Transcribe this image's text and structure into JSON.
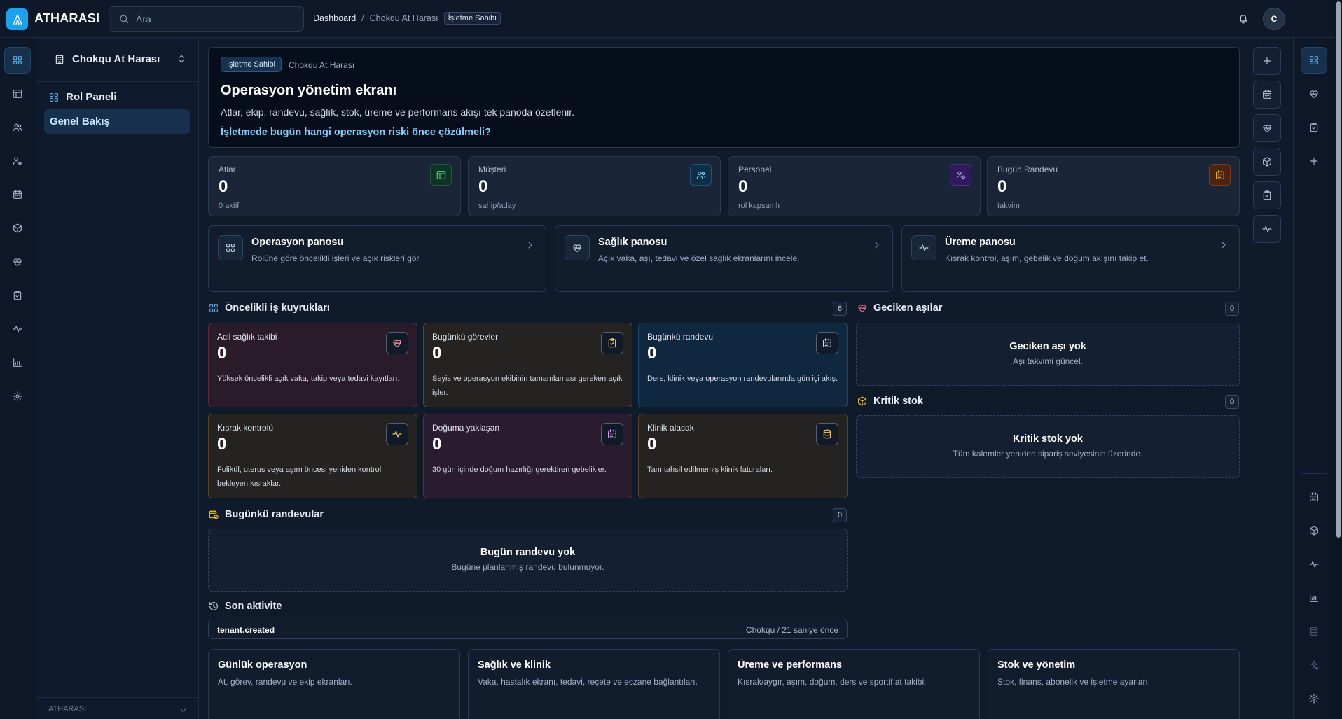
{
  "app": {
    "brand": "ATHARASI",
    "search_placeholder": "Ara"
  },
  "breadcrumb": {
    "home": "Dashboard",
    "separator": "/",
    "current": "Chokqu At Harası",
    "role_tag": "İşletme Sahibi"
  },
  "user": {
    "avatar_initial": "C"
  },
  "sidebar": {
    "workspace": "Chokqu At Harası",
    "section": "Rol Paneli",
    "active_item": "Genel Bakış",
    "footer": "ATHARASI"
  },
  "hero": {
    "badge": "İşletme Sahibi",
    "context": "Chokqu At Harası",
    "title": "Operasyon yönetim ekranı",
    "description": "Atlar, ekip, randevu, sağlık, stok, üreme ve performans akışı tek panoda özetlenir.",
    "question": "İşletmede bugün hangi operasyon riski önce çözülmeli?"
  },
  "stats": [
    {
      "label": "Atlar",
      "value": "0",
      "sub": "0 aktif",
      "icon": "horse-board-icon",
      "color": "#22c55e"
    },
    {
      "label": "Müşteri",
      "value": "0",
      "sub": "sahip/aday",
      "icon": "users-icon",
      "color": "#38bdf8"
    },
    {
      "label": "Personel",
      "value": "0",
      "sub": "rol kapsamlı",
      "icon": "user-cog-icon",
      "color": "#a78bfa"
    },
    {
      "label": "Bugün Randevu",
      "value": "0",
      "sub": "takvim",
      "icon": "calendar-icon",
      "color": "#f59e0b"
    }
  ],
  "panels": [
    {
      "title": "Operasyon panosu",
      "desc": "Rolüne göre öncelikli işleri ve açık riskleri gör."
    },
    {
      "title": "Sağlık panosu",
      "desc": "Açık vaka, aşı, tedavi ve özel sağlık ekranlarını incele."
    },
    {
      "title": "Üreme panosu",
      "desc": "Kısrak kontrol, aşım, gebelik ve doğum akışını takip et."
    }
  ],
  "queues": {
    "title": "Öncelikli iş kuyrukları",
    "count": "6",
    "items": [
      {
        "label": "Acil sağlık takibi",
        "value": "0",
        "desc": "Yüksek öncelikli açık vaka, takip veya tedavi kayıtları."
      },
      {
        "label": "Bugünkü görevler",
        "value": "0",
        "desc": "Seyis ve operasyon ekibinin tamamlaması gereken açık işler."
      },
      {
        "label": "Bugünkü randevu",
        "value": "0",
        "desc": "Ders, klinik veya operasyon randevularında gün içi akış."
      },
      {
        "label": "Kısrak kontrolü",
        "value": "0",
        "desc": "Folikül, uterus veya aşım öncesi yeniden kontrol bekleyen kısraklar."
      },
      {
        "label": "Doğuma yaklaşan",
        "value": "0",
        "desc": "30 gün içinde doğum hazırlığı gerektiren gebelikler."
      },
      {
        "label": "Klinik alacak",
        "value": "0",
        "desc": "Tam tahsil edilmemiş klinik faturaları."
      }
    ]
  },
  "overdue_vaccines": {
    "title": "Geciken aşılar",
    "count": "0",
    "empty_title": "Geciken aşı yok",
    "empty_desc": "Aşı takvimi güncel."
  },
  "critical_stock": {
    "title": "Kritik stok",
    "count": "0",
    "empty_title": "Kritik stok yok",
    "empty_desc": "Tüm kalemler yeniden sipariş seviyesinin üzerinde."
  },
  "appointments": {
    "title": "Bugünkü randevular",
    "count": "0",
    "empty_title": "Bugün randevu yok",
    "empty_desc": "Bugüne planlanmış randevu bulunmuyor."
  },
  "activity": {
    "title": "Son aktivite",
    "items": [
      {
        "name": "tenant.created",
        "meta": "Chokqu / 21 saniye önce"
      }
    ]
  },
  "bottom_cards": [
    {
      "title": "Günlük operasyon",
      "desc": "At, görev, randevu ve ekip ekranları."
    },
    {
      "title": "Sağlık ve klinik",
      "desc": "Vaka, hastalık ekranı, tedavi, reçete ve eczane bağlantıları."
    },
    {
      "title": "Üreme ve performans",
      "desc": "Kısrak/aygır, aşım, doğum, ders ve sportif at takibi."
    },
    {
      "title": "Stok ve yönetim",
      "desc": "Stok, finans, abonelik ve işletme ayarları."
    }
  ],
  "colors": {
    "accent": "#1aa3ec",
    "link": "#7fd0ff",
    "background": "#0f1a2b"
  }
}
